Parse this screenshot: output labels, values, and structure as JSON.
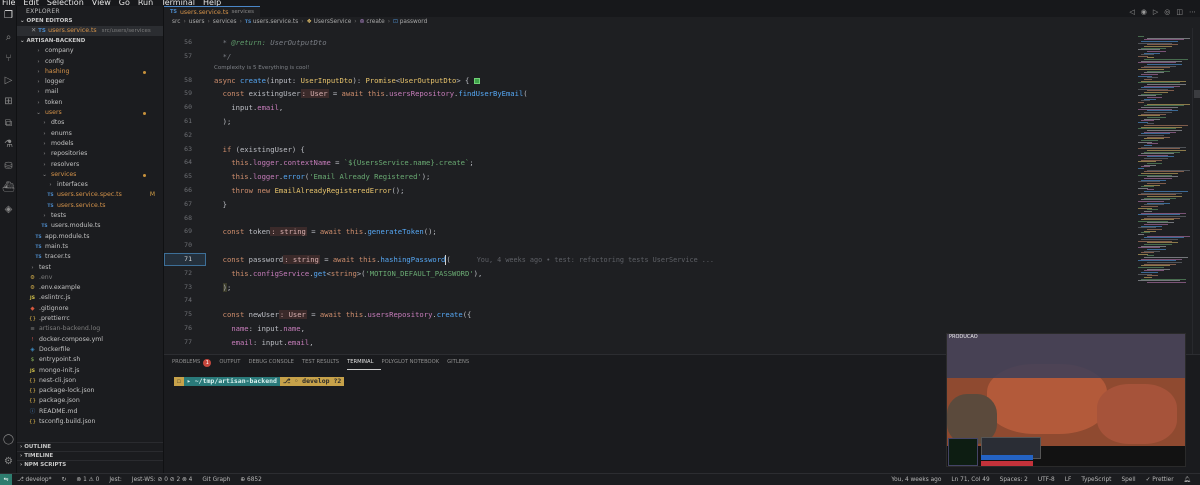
{
  "menu": [
    "File",
    "Edit",
    "Selection",
    "View",
    "Go",
    "Run",
    "Terminal",
    "Help"
  ],
  "activity_icons": [
    "files-icon",
    "search-icon",
    "source-control-icon",
    "run-debug-icon",
    "extensions-icon",
    "remote-explorer-icon",
    "testing-icon",
    "database-icon",
    "docker-icon",
    "gitlens-icon",
    "account-icon",
    "settings-gear-icon"
  ],
  "sidebar": {
    "title": "EXPLORER",
    "open_editors_label": "OPEN EDITORS",
    "open_editor": {
      "name": "users.service.ts",
      "path": "src/users/services"
    },
    "project_label": "ARTISAN-BACKEND",
    "tree": [
      {
        "label": "company",
        "type": "folder",
        "depth": 1
      },
      {
        "label": "config",
        "type": "folder",
        "depth": 1
      },
      {
        "label": "hashing",
        "type": "folder",
        "depth": 1,
        "modified": true
      },
      {
        "label": "logger",
        "type": "folder",
        "depth": 1
      },
      {
        "label": "mail",
        "type": "folder",
        "depth": 1
      },
      {
        "label": "token",
        "type": "folder",
        "depth": 1
      },
      {
        "label": "users",
        "type": "folder-open",
        "depth": 1,
        "modified": true
      },
      {
        "label": "dtos",
        "type": "folder",
        "depth": 2
      },
      {
        "label": "enums",
        "type": "folder",
        "depth": 2
      },
      {
        "label": "models",
        "type": "folder",
        "depth": 2
      },
      {
        "label": "repositories",
        "type": "folder",
        "depth": 2
      },
      {
        "label": "resolvers",
        "type": "folder",
        "depth": 2
      },
      {
        "label": "services",
        "type": "folder-open",
        "depth": 2,
        "modified": true
      },
      {
        "label": "interfaces",
        "type": "folder",
        "depth": 3
      },
      {
        "label": "users.service.spec.ts",
        "type": "ts",
        "depth": 3,
        "modified": true,
        "mark": "M"
      },
      {
        "label": "users.service.ts",
        "type": "ts",
        "depth": 3,
        "modified": true
      },
      {
        "label": "tests",
        "type": "folder",
        "depth": 2
      },
      {
        "label": "users.module.ts",
        "type": "ts",
        "depth": 2
      },
      {
        "label": "app.module.ts",
        "type": "ts",
        "depth": 1
      },
      {
        "label": "main.ts",
        "type": "ts",
        "depth": 1
      },
      {
        "label": "tracer.ts",
        "type": "ts",
        "depth": 1
      },
      {
        "label": "test",
        "type": "folder",
        "depth": 0
      },
      {
        "label": ".env",
        "type": "env",
        "depth": 0,
        "dim": true
      },
      {
        "label": ".env.example",
        "type": "env",
        "depth": 0
      },
      {
        "label": ".eslintrc.js",
        "type": "js",
        "depth": 0
      },
      {
        "label": ".gitignore",
        "type": "git",
        "depth": 0
      },
      {
        "label": ".prettierrc",
        "type": "json",
        "depth": 0
      },
      {
        "label": "artisan-backend.log",
        "type": "log",
        "depth": 0,
        "dim": true
      },
      {
        "label": "docker-compose.yml",
        "type": "yml",
        "depth": 0
      },
      {
        "label": "Dockerfile",
        "type": "docker",
        "depth": 0
      },
      {
        "label": "entrypoint.sh",
        "type": "sh",
        "depth": 0
      },
      {
        "label": "mongo-init.js",
        "type": "js",
        "depth": 0
      },
      {
        "label": "nest-cli.json",
        "type": "json",
        "depth": 0
      },
      {
        "label": "package-lock.json",
        "type": "json",
        "depth": 0
      },
      {
        "label": "package.json",
        "type": "json",
        "depth": 0
      },
      {
        "label": "README.md",
        "type": "md",
        "depth": 0
      },
      {
        "label": "tsconfig.build.json",
        "type": "json",
        "depth": 0
      }
    ],
    "outline_label": "OUTLINE",
    "timeline_label": "TIMELINE",
    "npm_label": "NPM SCRIPTS"
  },
  "tab": {
    "name": "users.service.ts",
    "path": "services"
  },
  "breadcrumb": [
    "src",
    "users",
    "services",
    "users.service.ts",
    "UsersService",
    "create",
    "password"
  ],
  "codelens": "Complexity is 5 Everything is cool!",
  "code": [
    {
      "n": "56",
      "kind": "comment-return"
    },
    {
      "n": "57",
      "kind": "comment-end"
    },
    {
      "n": "58",
      "kind": "signature"
    },
    {
      "n": "59",
      "kind": "existing"
    },
    {
      "n": "60",
      "kind": "email-arg"
    },
    {
      "n": "61",
      "kind": "close-paren"
    },
    {
      "n": "62",
      "kind": "blank"
    },
    {
      "n": "63",
      "kind": "if"
    },
    {
      "n": "64",
      "kind": "context"
    },
    {
      "n": "65",
      "kind": "error"
    },
    {
      "n": "66",
      "kind": "throw"
    },
    {
      "n": "67",
      "kind": "close-brace"
    },
    {
      "n": "68",
      "kind": "blank"
    },
    {
      "n": "69",
      "kind": "token"
    },
    {
      "n": "70",
      "kind": "blank"
    },
    {
      "n": "71",
      "kind": "password"
    },
    {
      "n": "72",
      "kind": "config"
    },
    {
      "n": "73",
      "kind": "close-paren"
    },
    {
      "n": "74",
      "kind": "blank"
    },
    {
      "n": "75",
      "kind": "newuser"
    },
    {
      "n": "76",
      "kind": "name"
    },
    {
      "n": "77",
      "kind": "email"
    }
  ],
  "code_text": {
    "return_tag": "@return",
    "return_type": "UserOutputDto",
    "user_type": "User",
    "string_type": "string",
    "context_string": "`${UsersService.name}.create`",
    "error_string": "'Email Already Registered'",
    "config_string": "'MOTION_DEFAULT_PASSWORD'",
    "blame": "You, 4 weeks ago • test: refactoring tests UserService ..."
  },
  "panel": {
    "tabs": [
      {
        "label": "PROBLEMS",
        "badge": "1"
      },
      {
        "label": "OUTPUT"
      },
      {
        "label": "DEBUG CONSOLE"
      },
      {
        "label": "TEST RESULTS"
      },
      {
        "label": "TERMINAL",
        "active": true
      },
      {
        "label": "POLYGLOT NOTEBOOK"
      },
      {
        "label": "GITLENS"
      }
    ],
    "prompt_path": "~/tmp/artisan-backend",
    "prompt_branch": "develop ?2"
  },
  "video": {
    "label": "PRODUCAO"
  },
  "status": {
    "branch": "develop*",
    "errors": "⊗ 1 ⚠ 0",
    "jest": "Jest:",
    "jest_ws": "Jest-WS: ⊘ 0 ⊘ 2 ⊗ 4",
    "git_graph": "Git Graph",
    "port": "⊕ 6852",
    "blame": "You, 4 weeks ago",
    "position": "Ln 71, Col 49",
    "spaces": "Spaces: 2",
    "encoding": "UTF-8",
    "eol": "LF",
    "language": "TypeScript",
    "spell": "Spell",
    "prettier": "✓ Prettier"
  },
  "colors": {
    "accent": "#4a86c8",
    "modified": "#d7944a",
    "remote": "#2e7d6f"
  }
}
